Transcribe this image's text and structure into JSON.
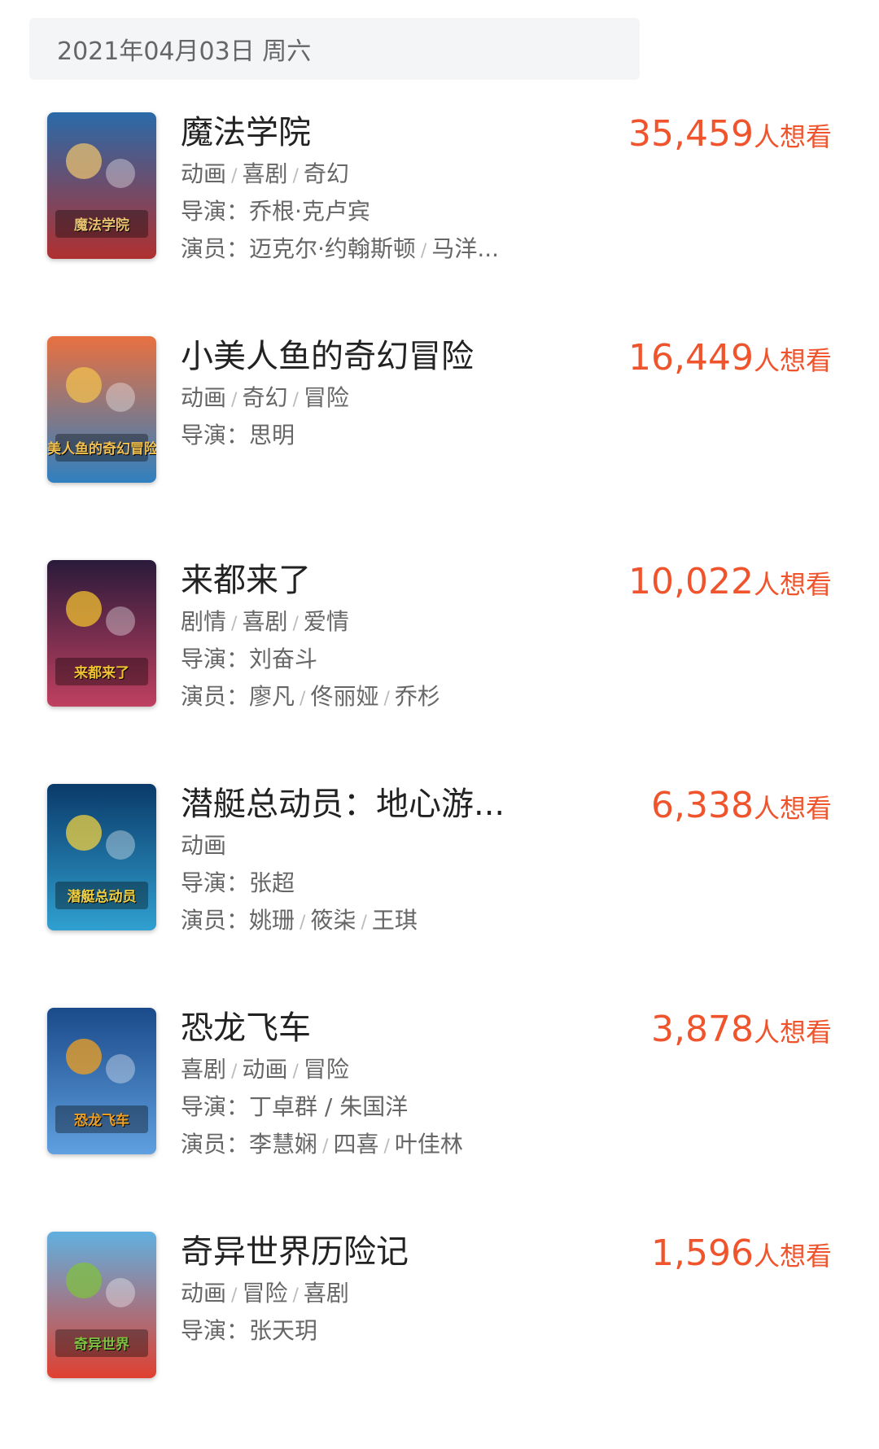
{
  "date_header": "2021年04月03日 周六",
  "colors": {
    "accent": "#f0542d",
    "title": "#222222",
    "meta": "#666666",
    "header_bg": "#f4f5f7"
  },
  "movies": [
    {
      "title": "魔法学院",
      "genres": [
        "动画",
        "喜剧",
        "奇幻"
      ],
      "director_label": "导演：",
      "directors": "乔根·克卢宾",
      "cast_label": "演员：",
      "cast": [
        "迈克尔·约翰斯顿",
        "马洋..."
      ],
      "want_count": "35,459",
      "want_suffix": "人想看",
      "poster_text": "魔法学院",
      "poster_colors": [
        "#2a6aa8",
        "#b03030",
        "#e8c070"
      ]
    },
    {
      "title": "小美人鱼的奇幻冒险",
      "genres": [
        "动画",
        "奇幻",
        "冒险"
      ],
      "director_label": "导演：",
      "directors": "思明",
      "cast_label": "",
      "cast": [],
      "want_count": "16,449",
      "want_suffix": "人想看",
      "poster_text": "美人鱼的奇幻冒险",
      "poster_colors": [
        "#e87040",
        "#3080c0",
        "#f0c050"
      ]
    },
    {
      "title": "来都来了",
      "genres": [
        "剧情",
        "喜剧",
        "爱情"
      ],
      "director_label": "导演：",
      "directors": "刘奋斗",
      "cast_label": "演员：",
      "cast": [
        "廖凡",
        "佟丽娅",
        "乔杉"
      ],
      "want_count": "10,022",
      "want_suffix": "人想看",
      "poster_text": "来都来了",
      "poster_colors": [
        "#2a1a3a",
        "#c04060",
        "#f0c030"
      ]
    },
    {
      "title": "潜艇总动员：地心游...",
      "genres": [
        "动画"
      ],
      "director_label": "导演：",
      "directors": "张超",
      "cast_label": "演员：",
      "cast": [
        "姚珊",
        "筱柒",
        "王琪"
      ],
      "want_count": "6,338",
      "want_suffix": "人想看",
      "poster_text": "潜艇总动员",
      "poster_colors": [
        "#0a3a6a",
        "#30a0d0",
        "#f0d040"
      ]
    },
    {
      "title": "恐龙飞车",
      "genres": [
        "喜剧",
        "动画",
        "冒险"
      ],
      "director_label": "导演：",
      "directors": "丁卓群 / 朱国洋",
      "cast_label": "演员：",
      "cast": [
        "李慧娴",
        "四喜",
        "叶佳林"
      ],
      "want_count": "3,878",
      "want_suffix": "人想看",
      "poster_text": "恐龙飞车",
      "poster_colors": [
        "#1a4a8a",
        "#60a0e0",
        "#f0a020"
      ]
    },
    {
      "title": "奇异世界历险记",
      "genres": [
        "动画",
        "冒险",
        "喜剧"
      ],
      "director_label": "导演：",
      "directors": "张天玥",
      "cast_label": "",
      "cast": [],
      "want_count": "1,596",
      "want_suffix": "人想看",
      "poster_text": "奇异世界",
      "poster_colors": [
        "#60b0e0",
        "#e04030",
        "#80c040"
      ]
    }
  ]
}
